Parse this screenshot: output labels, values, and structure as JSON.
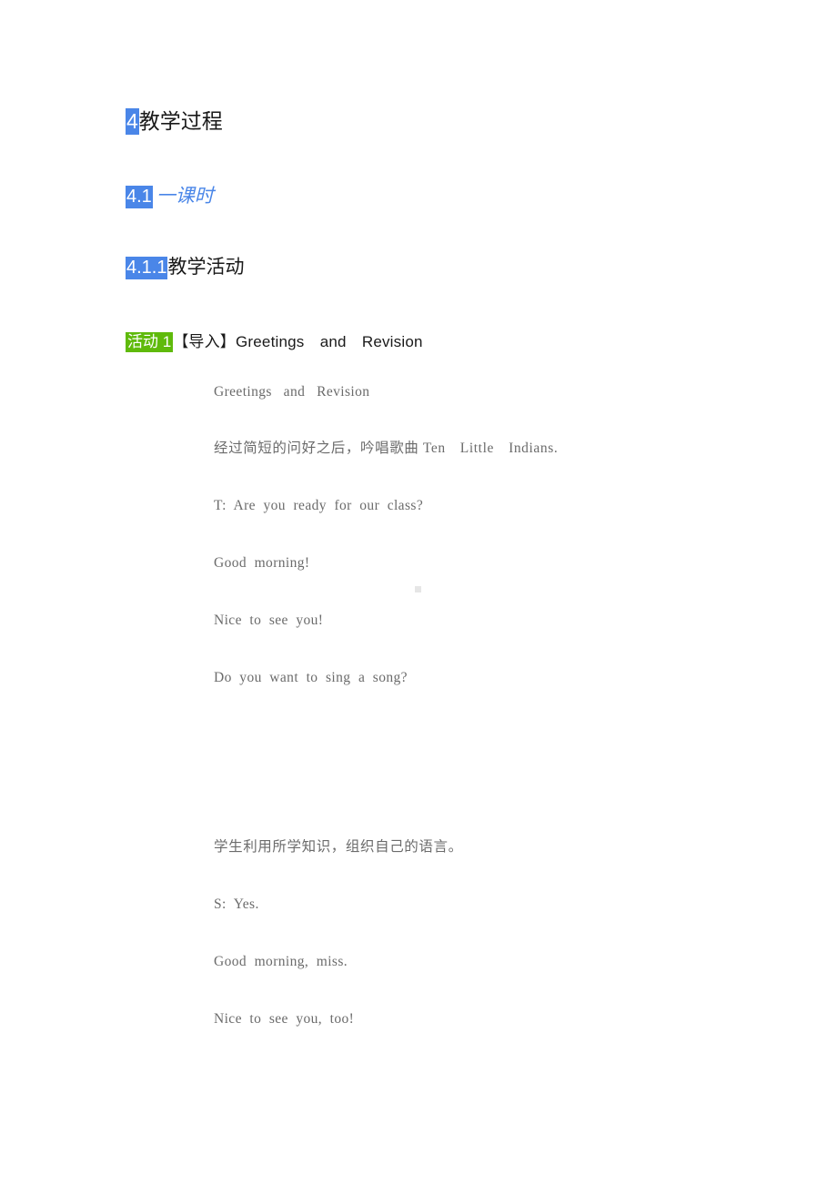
{
  "document": {
    "headings": [
      {
        "number": "4",
        "title": "教学过程",
        "highlight": "#4a86e8"
      },
      {
        "number": "4.1",
        "title": "一课时",
        "highlight": "#4a86e8"
      },
      {
        "number": "4.1.1",
        "title": "教学活动",
        "highlight": "#4a86e8"
      },
      {
        "number": "活动 1",
        "title": "【导入】Greetings　and　Revision",
        "highlight": "#5fba0b"
      }
    ],
    "body_lines": [
      {
        "text": "Greetings   and   Revision"
      },
      {
        "text": "经过简短的问好之后，吟唱歌曲 Ten　Little　Indians."
      },
      {
        "text": "T:  Are  you  ready  for  our  class?"
      },
      {
        "text": "Good  morning!"
      },
      {
        "text": "Nice  to  see  you!"
      },
      {
        "text": "Do  you  want  to  sing  a  song?"
      },
      {
        "text": "学生利用所学知识，组织自己的语言。"
      },
      {
        "text": "S:  Yes."
      },
      {
        "text": "Good  morning,  miss."
      },
      {
        "text": "Nice  to  see  you,  too!"
      }
    ],
    "colors": {
      "heading_blue": "#4a86e8",
      "heading_green": "#5fba0b",
      "body_text": "#6b6b6b",
      "title_text": "#1a1a1a",
      "page_background": "#ffffff",
      "anchor_mark": "#e6e6e6"
    }
  }
}
